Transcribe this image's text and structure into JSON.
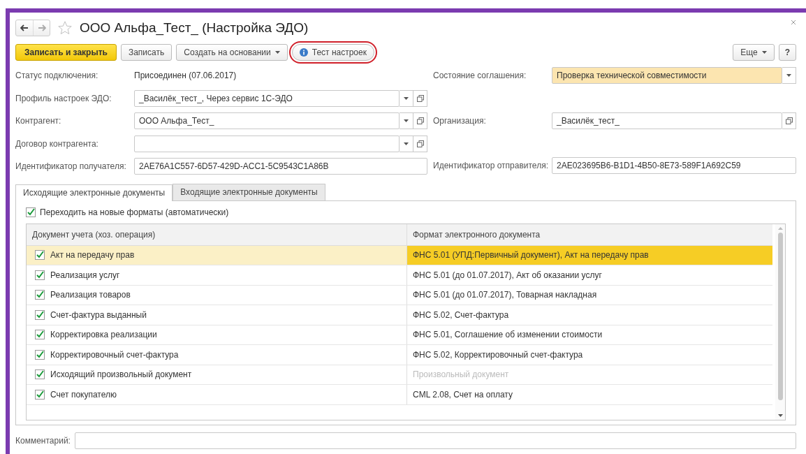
{
  "window": {
    "title": "ООО Альфа_Тест_ (Настройка ЭДО)",
    "favorite": false
  },
  "toolbar": {
    "buttons": [
      {
        "label": "Записать и закрыть",
        "kind": "primary",
        "circled": false
      },
      {
        "label": "Записать",
        "kind": "plain",
        "circled": false
      },
      {
        "label": "Создать на основании",
        "kind": "menu",
        "circled": false
      },
      {
        "label": "Тест настроек",
        "kind": "info",
        "circled": true
      }
    ],
    "right_buttons": [
      {
        "label": "Еще",
        "kind": "menu"
      },
      {
        "label": "?",
        "kind": "plain"
      }
    ]
  },
  "left_fields": [
    {
      "label": "Статус подключения:",
      "value": "Присоединен (07.06.2017)",
      "kind": "text"
    },
    {
      "label": "Профиль настроек ЭДО:",
      "value": "_Василёк_тест_, Через сервис 1С-ЭДО",
      "kind": "select"
    },
    {
      "label": "Контрагент:",
      "value": "ООО Альфа_Тест_",
      "kind": "select"
    },
    {
      "label": "Договор контрагента:",
      "kind": "select"
    },
    {
      "label": "Идентификатор получателя:",
      "value": "2AE76A1C557-6D57-429D-ACC1-5C9543C1A86B",
      "kind": "input"
    }
  ],
  "right_fields": [
    {
      "label": "Состояние соглашения:",
      "value": "Проверка технической совместимости",
      "kind": "dropdown"
    },
    {
      "label": "Организация:",
      "value": "_Василёк_тест_",
      "kind": "link"
    },
    {
      "label": "Идентификатор отправителя:",
      "value": "2AE023695B6-B1D1-4B50-8E73-589F1A692C59",
      "kind": "input"
    }
  ],
  "tabs": [
    {
      "label": "Исходящие электронные документы",
      "selected": true
    },
    {
      "label": "Входящие электронные документы",
      "selected": false
    }
  ],
  "auto_formats": {
    "label": "Переходить на новые форматы (автоматически)",
    "checked": true
  },
  "table": {
    "columns": [
      "Документ учета (хоз. операция)",
      "Формат электронного документа"
    ],
    "rows": [
      {
        "document": "Акт на передачу прав",
        "format": "ФНС 5.01 (УПД:Первичный документ), Акт на передачу прав",
        "checked": true,
        "selected": true,
        "muted": false
      },
      {
        "document": "Реализация услуг",
        "format": "ФНС 5.01 (до 01.07.2017), Акт об оказании услуг",
        "checked": true,
        "selected": false,
        "muted": false
      },
      {
        "document": "Реализация товаров",
        "format": "ФНС 5.01 (до 01.07.2017), Товарная накладная",
        "checked": true,
        "selected": false,
        "muted": false
      },
      {
        "document": "Счет-фактура выданный",
        "format": "ФНС 5.02, Счет-фактура",
        "checked": true,
        "selected": false,
        "muted": false
      },
      {
        "document": "Корректировка реализации",
        "format": "ФНС 5.01, Соглашение об изменении стоимости",
        "checked": true,
        "selected": false,
        "muted": false
      },
      {
        "document": "Корректировочный счет-фактура",
        "format": "ФНС 5.02, Корректировочный счет-фактура",
        "checked": true,
        "selected": false,
        "muted": false
      },
      {
        "document": "Исходящий произвольный документ",
        "format": "Произвольный документ",
        "checked": true,
        "selected": false,
        "muted": true
      },
      {
        "document": "Счет покупателю",
        "format": "CML 2.08, Счет на оплату",
        "checked": true,
        "selected": false,
        "muted": false
      }
    ]
  },
  "comment": {
    "label": "Комментарий:"
  }
}
